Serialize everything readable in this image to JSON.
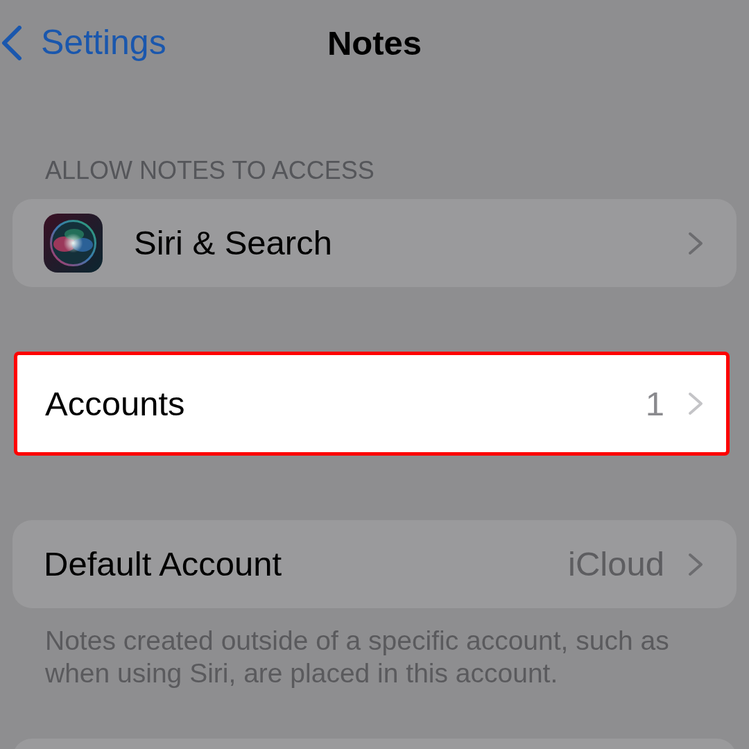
{
  "nav": {
    "back_label": "Settings",
    "title": "Notes"
  },
  "sections": [
    {
      "header": "ALLOW NOTES TO ACCESS",
      "rows": [
        {
          "kind": "app",
          "label": "Siri & Search",
          "highlighted": false
        }
      ]
    },
    {
      "rows": [
        {
          "kind": "plain",
          "label": "Accounts",
          "value": "1",
          "highlighted": true
        }
      ]
    },
    {
      "rows": [
        {
          "kind": "plain",
          "label": "Default Account",
          "value": "iCloud",
          "highlighted": false
        }
      ],
      "footer": "Notes created outside of a specific account, such as when using Siri, are placed in this account."
    },
    {
      "rows": [
        {
          "kind": "blank",
          "highlighted": false
        }
      ]
    }
  ]
}
